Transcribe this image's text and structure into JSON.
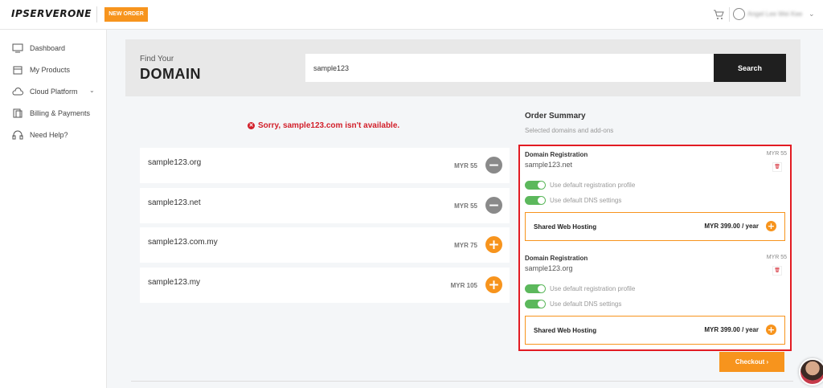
{
  "header": {
    "logo": "IPSERVERONE",
    "new_order": "NEW ORDER",
    "user_name": "Angel Lee Wei Kee"
  },
  "sidebar": {
    "items": [
      {
        "label": "Dashboard",
        "icon": "monitor-icon"
      },
      {
        "label": "My Products",
        "icon": "box-icon"
      },
      {
        "label": "Cloud Platform",
        "icon": "cloud-icon"
      },
      {
        "label": "Billing & Payments",
        "icon": "billing-icon"
      },
      {
        "label": "Need Help?",
        "icon": "headset-icon"
      }
    ]
  },
  "search": {
    "find_your": "Find Your",
    "domain": "DOMAIN",
    "value": "sample123",
    "button": "Search"
  },
  "error": "Sorry, sample123.com isn't available.",
  "results": [
    {
      "domain": "sample123.org",
      "price": "MYR 55",
      "action": "remove"
    },
    {
      "domain": "sample123.net",
      "price": "MYR 55",
      "action": "remove"
    },
    {
      "domain": "sample123.com.my",
      "price": "MYR 75",
      "action": "add"
    },
    {
      "domain": "sample123.my",
      "price": "MYR 105",
      "action": "add"
    }
  ],
  "order_summary": {
    "title": "Order Summary",
    "subtitle": "Selected domains and add-ons",
    "registrations": [
      {
        "title": "Domain Registration",
        "domain": "sample123.net",
        "price": "MYR 55",
        "toggle1": "Use default registration profile",
        "toggle2": "Use default DNS settings",
        "hosting_name": "Shared Web Hosting",
        "hosting_price": "MYR 399.00 / year"
      },
      {
        "title": "Domain Registration",
        "domain": "sample123.org",
        "price": "MYR 55",
        "toggle1": "Use default registration profile",
        "toggle2": "Use default DNS settings",
        "hosting_name": "Shared Web Hosting",
        "hosting_price": "MYR 399.00 / year"
      }
    ],
    "checkout": "Checkout  ›"
  },
  "colors": {
    "accent": "#f7941d",
    "error": "#d21f2a",
    "toggle_on": "#5cb85c",
    "highlight_border": "#e21b23"
  }
}
